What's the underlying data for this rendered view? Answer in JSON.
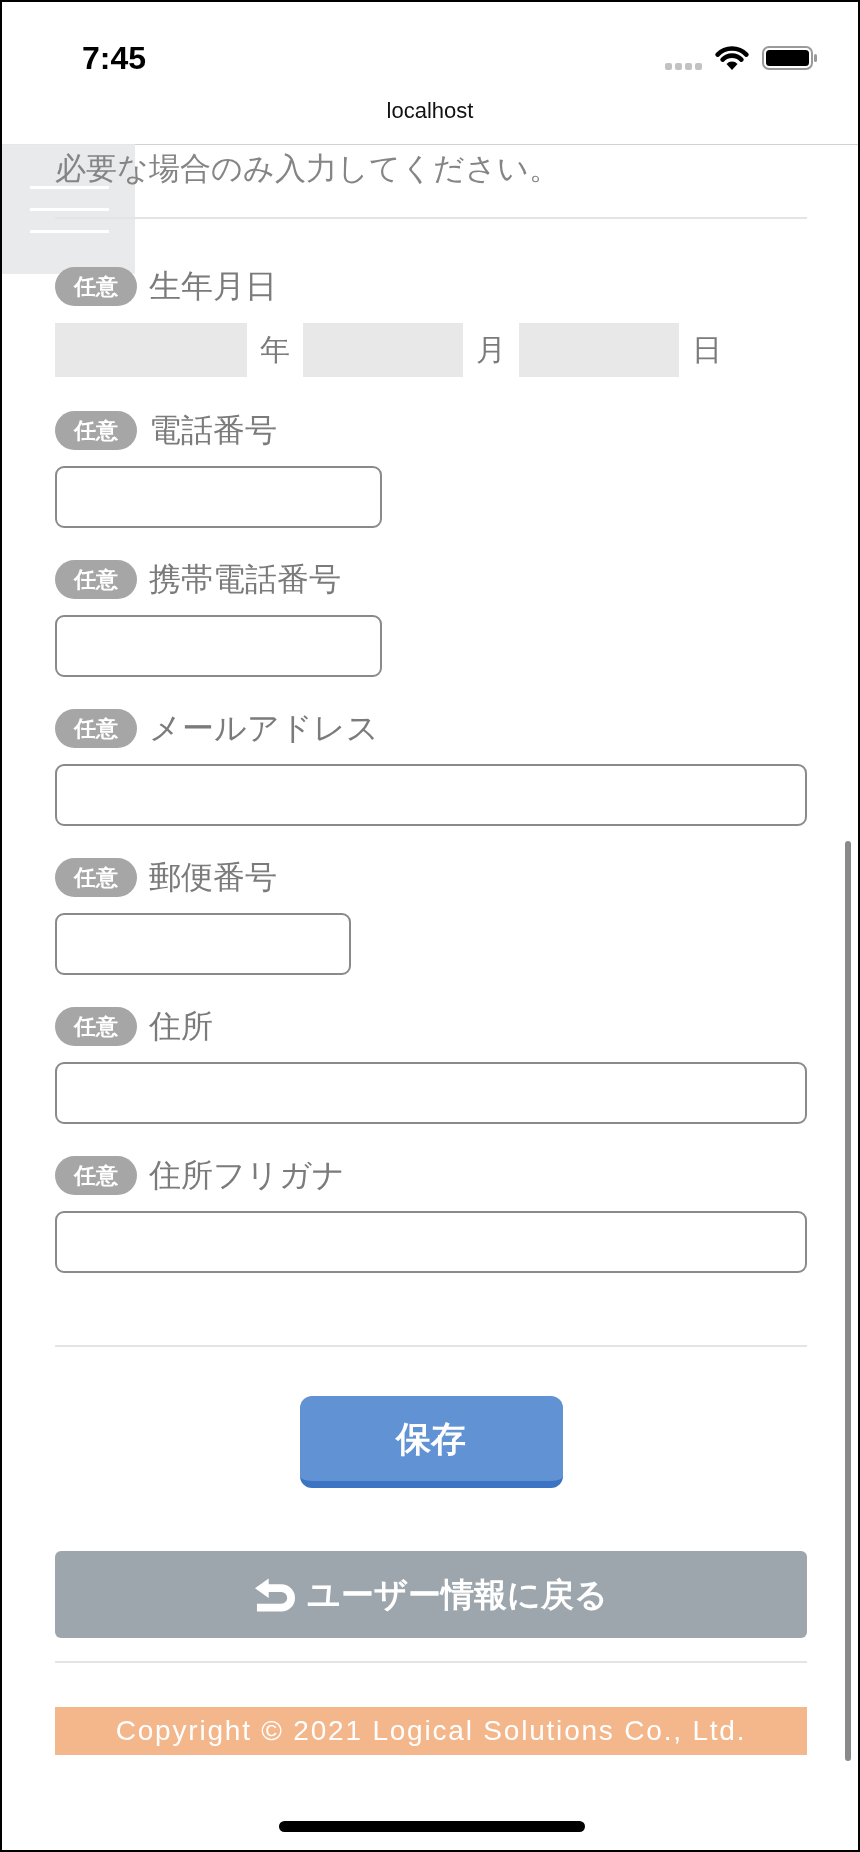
{
  "status_bar": {
    "time": "7:45"
  },
  "address_bar": {
    "url": "localhost"
  },
  "form": {
    "note": "必要な場合のみ入力してください。",
    "fields": [
      {
        "kind": "date",
        "badge": "任意",
        "label": "生年月日",
        "parts": [
          {
            "unit": "年"
          },
          {
            "unit": "月"
          },
          {
            "unit": "日"
          }
        ]
      },
      {
        "kind": "medium",
        "badge": "任意",
        "label": "電話番号"
      },
      {
        "kind": "medium",
        "badge": "任意",
        "label": "携帯電話番号"
      },
      {
        "kind": "wide",
        "badge": "任意",
        "label": "メールアドレス"
      },
      {
        "kind": "short",
        "badge": "任意",
        "label": "郵便番号"
      },
      {
        "kind": "wide",
        "badge": "任意",
        "label": "住所"
      },
      {
        "kind": "wide",
        "badge": "任意",
        "label": "住所フリガナ"
      }
    ]
  },
  "actions": {
    "save": "保存",
    "back": "ユーザー情報に戻る"
  },
  "footer": {
    "copyright": "Copyright © 2021 Logical Solutions Co., Ltd."
  }
}
